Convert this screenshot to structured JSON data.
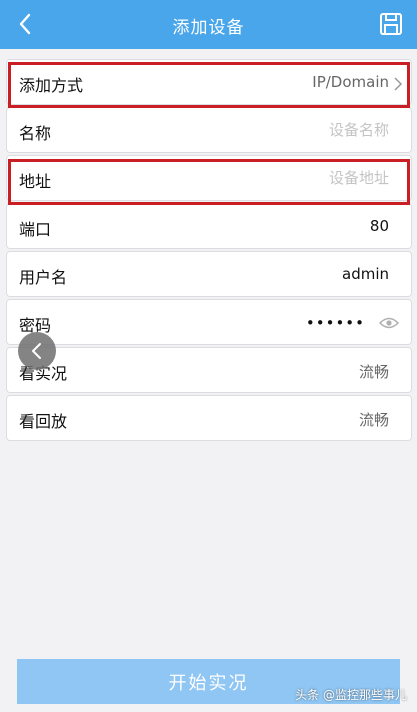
{
  "header": {
    "title": "添加设备",
    "back_icon": "chevron-left-icon",
    "save_icon": "save-icon"
  },
  "form": {
    "method": {
      "label": "添加方式",
      "value": "IP/Domain"
    },
    "name": {
      "label": "名称",
      "placeholder": "设备名称"
    },
    "address": {
      "label": "地址",
      "placeholder": "设备地址"
    },
    "port": {
      "label": "端口",
      "value": "80"
    },
    "username": {
      "label": "用户名",
      "value": "admin"
    },
    "password": {
      "label": "密码",
      "value": "••••••"
    },
    "live": {
      "label": "看实况",
      "value": "流畅"
    },
    "playback": {
      "label": "看回放",
      "value": "流畅"
    }
  },
  "start_button": {
    "label": "开始实况"
  },
  "watermark": "头条 @监控那些事儿",
  "colors": {
    "header": "#4aa6ea",
    "button": "#8fc6f3",
    "highlight": "#c81e24"
  }
}
